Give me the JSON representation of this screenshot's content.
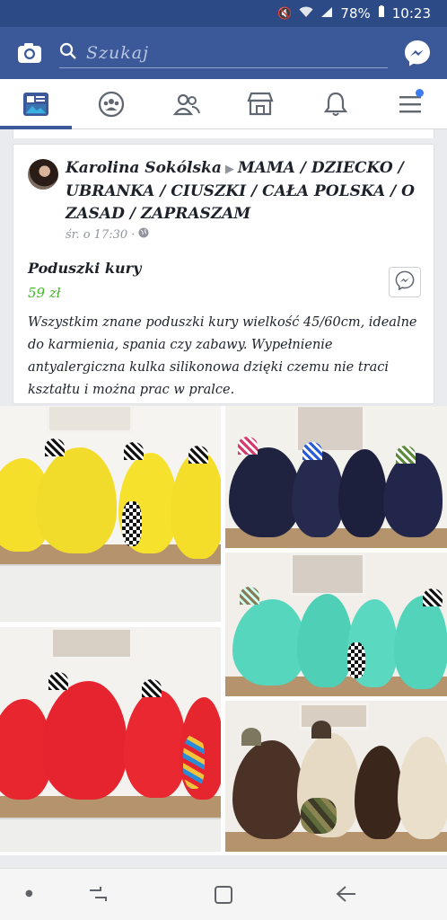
{
  "status": {
    "battery": "78%",
    "time": "10:23"
  },
  "header": {
    "search_placeholder": "Szukaj"
  },
  "tabs": [
    "News Feed",
    "Groups",
    "Friends",
    "Marketplace",
    "Notifications",
    "Menu"
  ],
  "post": {
    "author": "Karolina Sokólska",
    "arrow": "▶",
    "group": "MAMA / DZIECKO / UBRANKA / CIUSZKI / CAŁA POLSKA / O ZASAD / ZAPRASZAM",
    "time": "śr. o 17:30 ·",
    "product_title": "Poduszki kury",
    "price": "59 zł",
    "description": "Wszystkim znane poduszki kury wielkość 45/60cm, idealne do karmienia, spania czy zabawy. Wypełnienie antyalergiczna kulka silikonowa dzięki czemu nie traci kształtu i można prac w pralce."
  },
  "photos": [
    {
      "name": "yellow-hens-photo",
      "color": "#f5df2a"
    },
    {
      "name": "navy-hens-photo",
      "color": "#1f2340"
    },
    {
      "name": "mint-hens-photo",
      "color": "#56d6bd"
    },
    {
      "name": "red-hens-photo",
      "color": "#e8262f"
    },
    {
      "name": "brown-beige-hens-photo",
      "color": "#4a3226"
    }
  ],
  "colors": {
    "facebook_blue": "#3b5998",
    "status_bar": "#2c4a86",
    "price_green": "#42b72a"
  }
}
